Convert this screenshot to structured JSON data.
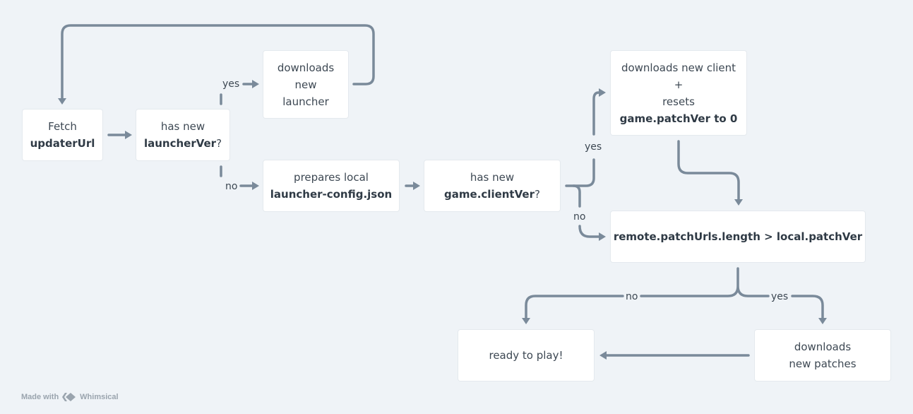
{
  "nodes": {
    "fetch": {
      "line1": "Fetch",
      "bold": "updaterUrl"
    },
    "has_launcher": {
      "line1": "has new",
      "bold": "launcherVer",
      "suffix": "?"
    },
    "download_launcher": {
      "line1": "downloads",
      "line2": "new",
      "line3": "launcher"
    },
    "prepare_config": {
      "line1": "prepares local",
      "bold": "launcher-config.json"
    },
    "has_client": {
      "line1": "has new",
      "bold": "game.clientVer",
      "suffix": "?"
    },
    "download_client": {
      "line1": "downloads new client",
      "line2": "+",
      "line3": "resets",
      "bold": "game.patchVer to 0"
    },
    "patch_check": {
      "bold": "remote.patchUrls.length > local.patchVer"
    },
    "ready": {
      "line1": "ready to play!"
    },
    "download_patches": {
      "line1": "downloads",
      "line2": "new patches"
    }
  },
  "edge_labels": {
    "launcher_yes": "yes",
    "launcher_no": "no",
    "client_yes": "yes",
    "client_no": "no",
    "patch_no": "no",
    "patch_yes": "yes"
  },
  "footer": {
    "made_with": "Made with",
    "brand": "Whimsical"
  }
}
